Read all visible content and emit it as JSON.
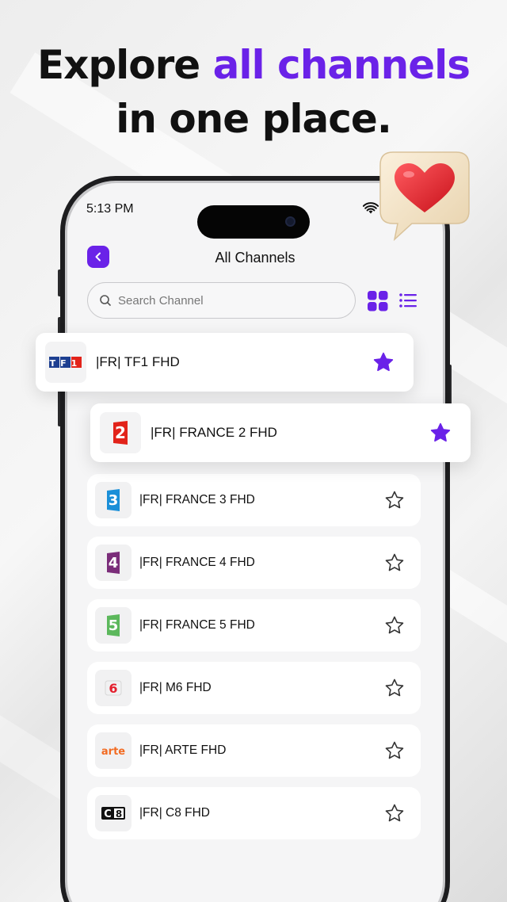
{
  "headline": {
    "line1_prefix": "Explore ",
    "line1_accent": "all channels",
    "line2": "in one place."
  },
  "colors": {
    "accent": "#6a22e8",
    "text": "#111111"
  },
  "status_bar": {
    "time": "5:13 PM"
  },
  "header": {
    "title": "All Channels",
    "back_icon": "chevron-left-icon"
  },
  "search": {
    "placeholder": "Search Channel",
    "value": ""
  },
  "view_toggle": {
    "grid_icon": "grid-icon",
    "list_icon": "list-icon"
  },
  "featured": [
    {
      "label": "|FR| TF1 FHD",
      "logo": "tf1-logo",
      "favorite": true
    },
    {
      "label": "|FR| FRANCE 2 FHD",
      "logo": "france2-logo",
      "favorite": true
    }
  ],
  "channels": [
    {
      "label": "|FR| FRANCE 3 FHD",
      "logo": "france3-logo",
      "favorite": false
    },
    {
      "label": "|FR| FRANCE 4 FHD",
      "logo": "france4-logo",
      "favorite": false
    },
    {
      "label": "|FR| FRANCE 5 FHD",
      "logo": "france5-logo",
      "favorite": false
    },
    {
      "label": "|FR| M6 FHD",
      "logo": "m6-logo",
      "favorite": false
    },
    {
      "label": "|FR| ARTE FHD",
      "logo": "arte-logo",
      "favorite": false
    },
    {
      "label": "|FR| C8 FHD",
      "logo": "c8-logo",
      "favorite": false
    }
  ],
  "logo_text": {
    "tf1": "TF1",
    "france2": "2",
    "france3": "3",
    "france4": "4",
    "france5": "5",
    "m6": "6",
    "arte": "arte",
    "c8_c": "C",
    "c8_8": "8"
  }
}
